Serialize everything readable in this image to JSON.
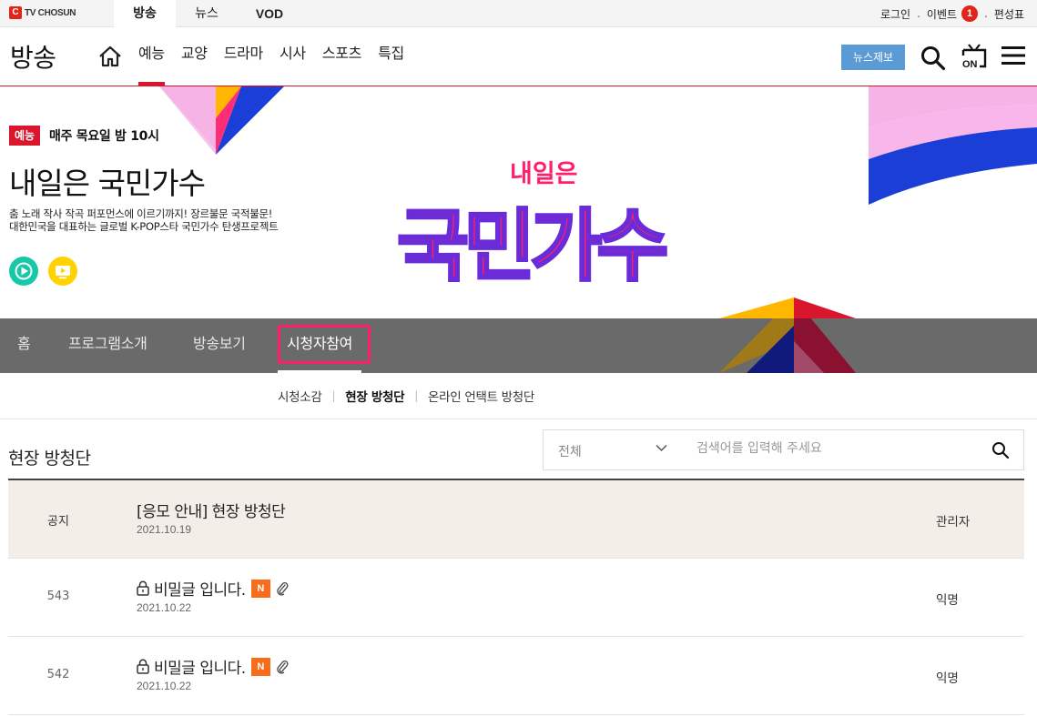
{
  "topbar": {
    "logo_text": "TV CHOSUN",
    "tabs": [
      {
        "label": "방송",
        "active": true
      },
      {
        "label": "뉴스",
        "active": false
      },
      {
        "label": "VOD",
        "active": false
      }
    ],
    "login": "로그인",
    "event": "이벤트",
    "event_count": "1",
    "schedule": "편성표",
    "separator": "."
  },
  "header": {
    "section_title": "방송",
    "gnb": [
      {
        "label": "예능",
        "active": true
      },
      {
        "label": "교양",
        "active": false
      },
      {
        "label": "드라마",
        "active": false
      },
      {
        "label": "시사",
        "active": false
      },
      {
        "label": "스포츠",
        "active": false
      },
      {
        "label": "특집",
        "active": false
      }
    ],
    "news_tip_label": "뉴스제보",
    "on_icon_label": "ON"
  },
  "hero": {
    "genre": "예능",
    "air_time": "매주 목요일 밤 10시",
    "title": "내일은 국민가수",
    "desc_line1": "춤 노래 작사 작곡 퍼포먼스에 이르기까지! 장르불문 국적불문!",
    "desc_line2": "대한민국을 대표하는 글로벌 K-POP스타 국민가수 탄생프로젝트",
    "logo_top": "내일은",
    "logo_main": "국민가수"
  },
  "program_nav": [
    {
      "label": "홈",
      "active": false
    },
    {
      "label": "프로그램소개",
      "active": false
    },
    {
      "label": "방송보기",
      "active": false
    },
    {
      "label": "시청자참여",
      "active": true
    }
  ],
  "sub_nav": [
    {
      "label": "시청소감",
      "active": false
    },
    {
      "label": "현장 방청단",
      "active": true
    },
    {
      "label": "온라인 언택트 방청단",
      "active": false
    }
  ],
  "board": {
    "title": "현장 방청단",
    "filter_value": "전체",
    "search_placeholder": "검색어를 입력해 주세요",
    "notice": {
      "no": "공지",
      "title": "[응모 안내] 현장 방청단",
      "date": "2021.10.19",
      "writer": "관리자"
    },
    "rows": [
      {
        "no": "543",
        "title": "비밀글 입니다.",
        "date": "2021.10.22",
        "writer": "익명",
        "new_badge": "N"
      },
      {
        "no": "542",
        "title": "비밀글 입니다.",
        "date": "2021.10.22",
        "writer": "익명",
        "new_badge": "N"
      }
    ]
  },
  "colors": {
    "accent_red": "#d9162c",
    "play_green": "#17c8a8",
    "tv_yellow": "#ffd200",
    "news_blue": "#5b9bd5",
    "new_orange": "#f86c1b",
    "focus_pink": "#ff1c6b"
  }
}
